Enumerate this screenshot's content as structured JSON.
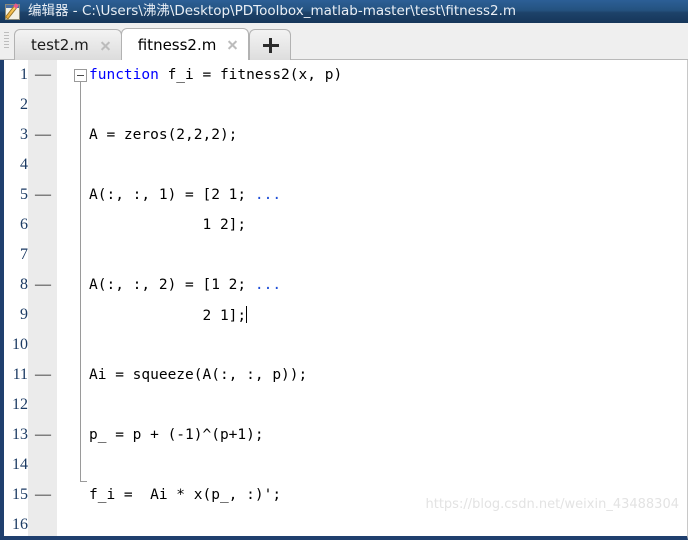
{
  "window": {
    "icon": "editor-document-pencil-icon",
    "title": "编辑器 - C:\\Users\\沸沸\\Desktop\\PDToolbox_matlab-master\\test\\fitness2.m"
  },
  "tabbar": {
    "grip_icon": "drag-grip-icon",
    "new_tab_label": "+",
    "new_tab_icon": "plus-icon",
    "close_icon": "close-x-icon",
    "tabs": [
      {
        "label": "test2.m",
        "active": false,
        "closable": true
      },
      {
        "label": "fitness2.m",
        "active": true,
        "closable": true
      }
    ]
  },
  "editor": {
    "fold_marker_icon": "collapse-minus-icon",
    "breakpoint_marker": "—",
    "lines": [
      {
        "num": "1",
        "executable": true,
        "segments": [
          {
            "t": "function",
            "c": "kw"
          },
          {
            "t": " f_i = fitness2(x, p)",
            "c": ""
          }
        ]
      },
      {
        "num": "2",
        "executable": false,
        "segments": []
      },
      {
        "num": "3",
        "executable": true,
        "segments": [
          {
            "t": "A = zeros(2,2,2);",
            "c": ""
          }
        ]
      },
      {
        "num": "4",
        "executable": false,
        "segments": []
      },
      {
        "num": "5",
        "executable": true,
        "segments": [
          {
            "t": "A(:, :, 1) = [2 1; ",
            "c": ""
          },
          {
            "t": "...",
            "c": "cont"
          }
        ]
      },
      {
        "num": "6",
        "executable": false,
        "segments": [
          {
            "t": "             1 2];",
            "c": ""
          }
        ]
      },
      {
        "num": "7",
        "executable": false,
        "segments": []
      },
      {
        "num": "8",
        "executable": true,
        "segments": [
          {
            "t": "A(:, :, 2) = [1 2; ",
            "c": ""
          },
          {
            "t": "...",
            "c": "cont"
          }
        ]
      },
      {
        "num": "9",
        "executable": false,
        "segments": [
          {
            "t": "             2 1];",
            "c": ""
          }
        ],
        "caret": true
      },
      {
        "num": "10",
        "executable": false,
        "segments": []
      },
      {
        "num": "11",
        "executable": true,
        "segments": [
          {
            "t": "Ai = squeeze(A(:, :, p));",
            "c": ""
          }
        ]
      },
      {
        "num": "12",
        "executable": false,
        "segments": []
      },
      {
        "num": "13",
        "executable": true,
        "segments": [
          {
            "t": "p_ = p + (-1)^(p+1);",
            "c": ""
          }
        ]
      },
      {
        "num": "14",
        "executable": false,
        "segments": []
      },
      {
        "num": "15",
        "executable": true,
        "segments": [
          {
            "t": "f_i =  Ai * x(p_, :)';",
            "c": ""
          }
        ]
      },
      {
        "num": "16",
        "executable": false,
        "segments": []
      }
    ]
  },
  "watermark": {
    "text": "https://blog.csdn.net/weixin_43488304"
  },
  "colors": {
    "titlebar_blue": "#24527f",
    "keyword_blue": "#0000ff",
    "continuation_blue": "#1f4fd8",
    "lineno_navy": "#1b3a63",
    "border_navy": "#1f3f6e",
    "gutter_gray": "#ebebeb"
  }
}
